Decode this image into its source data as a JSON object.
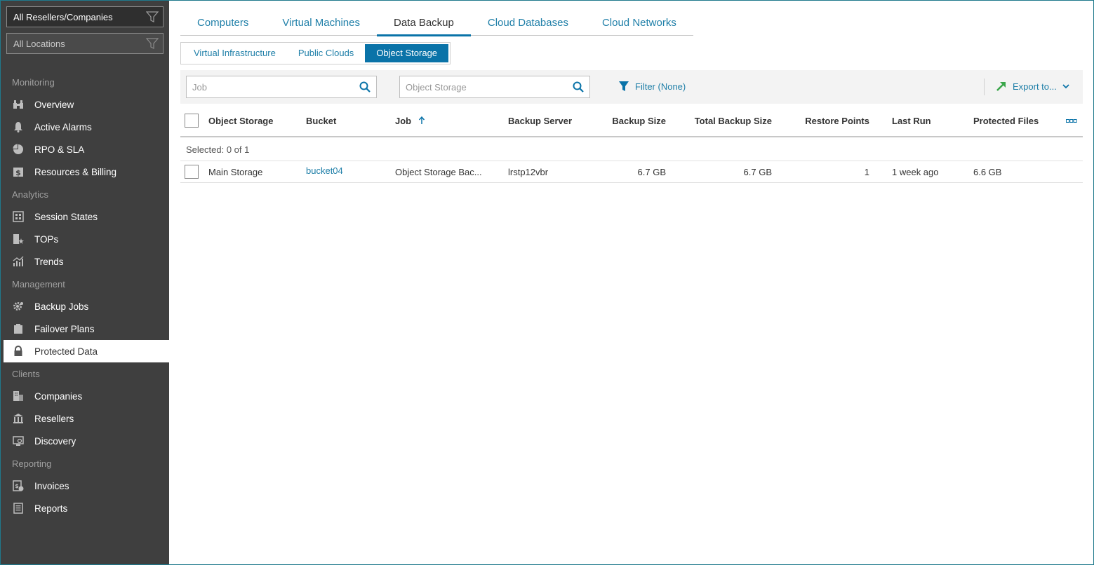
{
  "scope": {
    "resellers": "All Resellers/Companies",
    "locations": "All Locations"
  },
  "sidebar": {
    "sections": [
      {
        "title": "Monitoring",
        "items": [
          {
            "label": "Overview",
            "icon": "binoculars-icon"
          },
          {
            "label": "Active Alarms",
            "icon": "bell-icon"
          },
          {
            "label": "RPO & SLA",
            "icon": "pie-chart-icon"
          },
          {
            "label": "Resources & Billing",
            "icon": "dollar-icon"
          }
        ]
      },
      {
        "title": "Analytics",
        "items": [
          {
            "label": "Session States",
            "icon": "grid-icon"
          },
          {
            "label": "TOPs",
            "icon": "star-icon"
          },
          {
            "label": "Trends",
            "icon": "trend-icon"
          }
        ]
      },
      {
        "title": "Management",
        "items": [
          {
            "label": "Backup Jobs",
            "icon": "gear-icon"
          },
          {
            "label": "Failover Plans",
            "icon": "clipboard-icon"
          },
          {
            "label": "Protected Data",
            "icon": "lock-icon",
            "active": true
          }
        ]
      },
      {
        "title": "Clients",
        "items": [
          {
            "label": "Companies",
            "icon": "building-icon"
          },
          {
            "label": "Resellers",
            "icon": "bank-icon"
          },
          {
            "label": "Discovery",
            "icon": "monitor-icon"
          }
        ]
      },
      {
        "title": "Reporting",
        "items": [
          {
            "label": "Invoices",
            "icon": "invoice-icon"
          },
          {
            "label": "Reports",
            "icon": "report-icon"
          }
        ]
      }
    ]
  },
  "tabs": [
    "Computers",
    "Virtual Machines",
    "Data Backup",
    "Cloud Databases",
    "Cloud Networks"
  ],
  "active_tab": "Data Backup",
  "subtabs": [
    "Virtual Infrastructure",
    "Public Clouds",
    "Object Storage"
  ],
  "active_subtab": "Object Storage",
  "toolbar": {
    "job_placeholder": "Job",
    "storage_placeholder": "Object Storage",
    "filter_label": "Filter (None)",
    "export_label": "Export to..."
  },
  "grid": {
    "columns": {
      "object_storage": "Object Storage",
      "bucket": "Bucket",
      "job": "Job",
      "backup_server": "Backup Server",
      "backup_size": "Backup Size",
      "total_backup_size": "Total Backup Size",
      "restore_points": "Restore Points",
      "last_run": "Last Run",
      "protected_files": "Protected Files"
    },
    "selected_info": "Selected: 0 of 1",
    "rows": [
      {
        "object_storage": "Main Storage",
        "bucket": "bucket04",
        "job": "Object Storage Bac...",
        "backup_server": "lrstp12vbr",
        "backup_size": "6.7 GB",
        "total_backup_size": "6.7 GB",
        "restore_points": "1",
        "last_run": "1 week ago",
        "protected_files": "6.6 GB"
      }
    ]
  },
  "colors": {
    "accent": "#0a73a8",
    "link": "#1f7fa8",
    "sidebar_bg": "#3f3f3f",
    "export_arrow": "#3aa64a"
  }
}
